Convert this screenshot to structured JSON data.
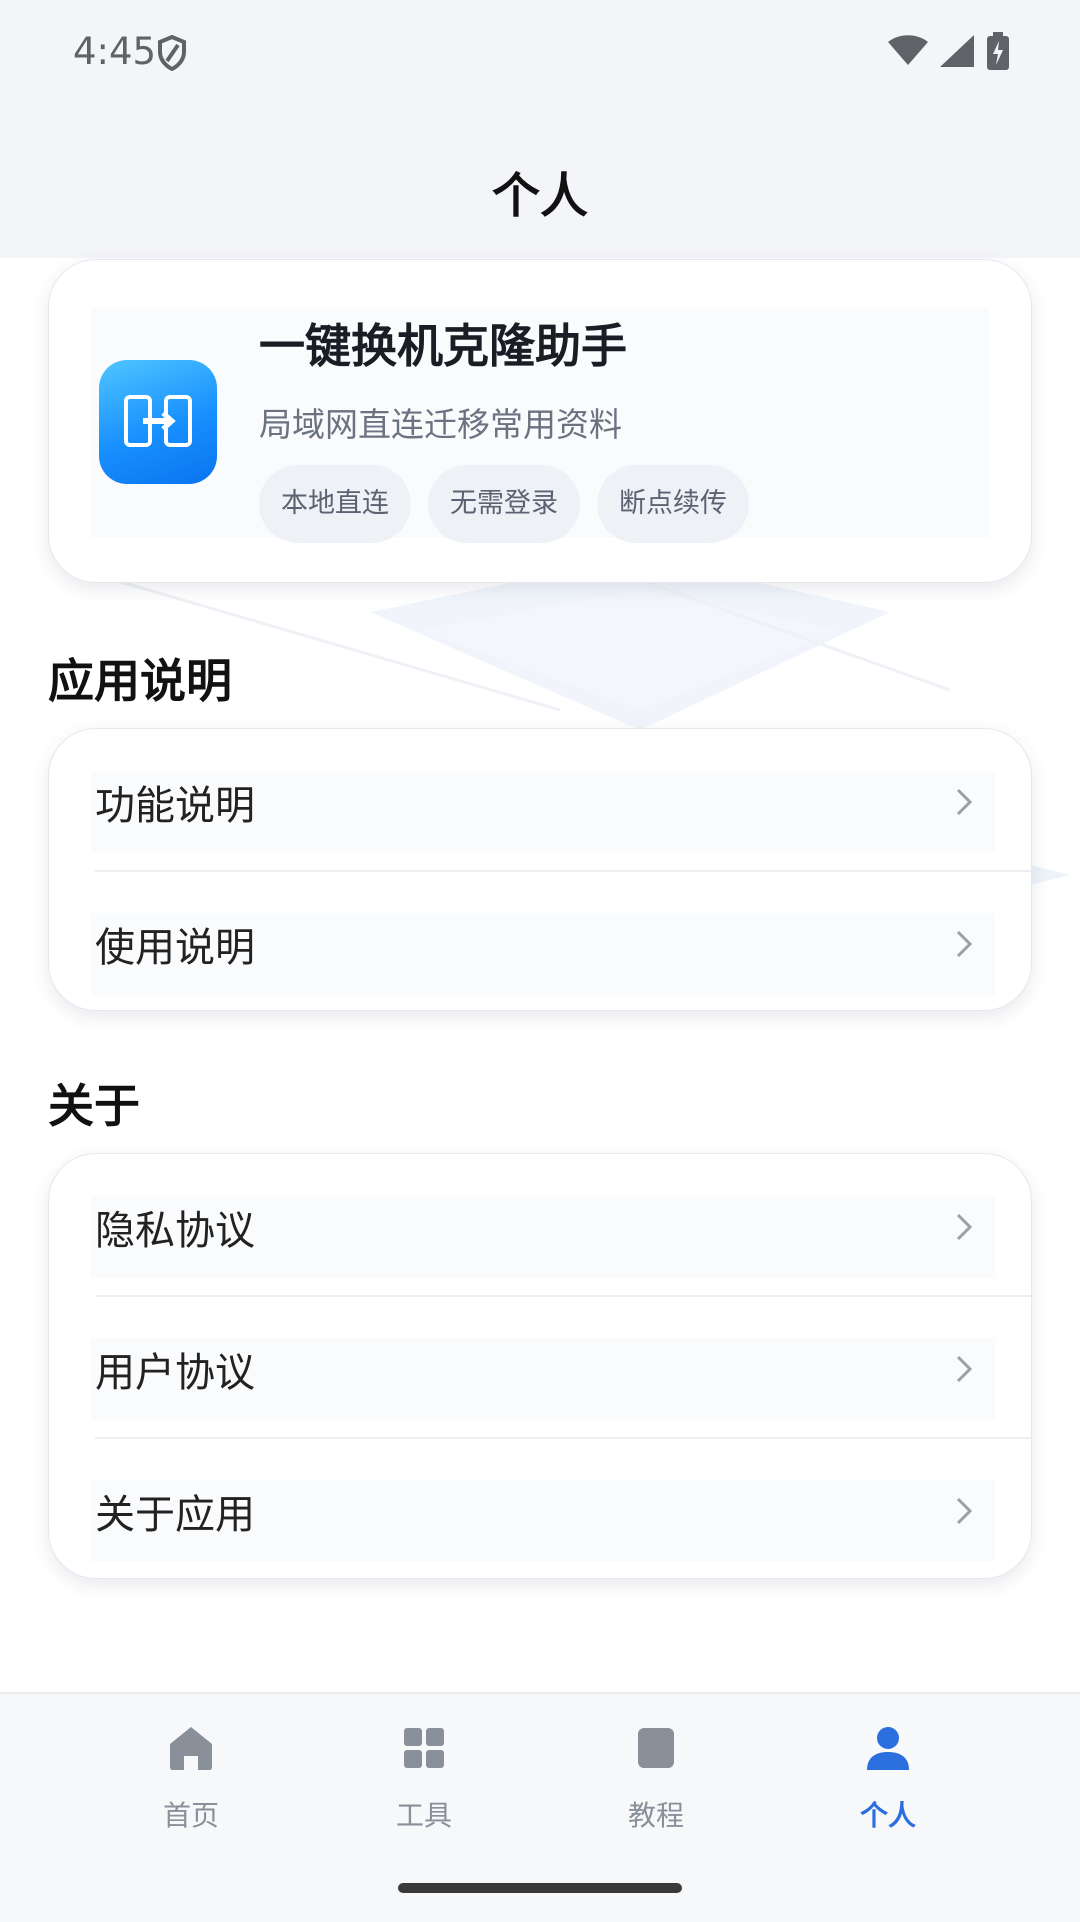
{
  "status_bar": {
    "time": "4:45"
  },
  "header": {
    "title": "个人"
  },
  "app_card": {
    "name": "一键换机克隆助手",
    "description": "局域网直连迁移常用资料",
    "tags": [
      "本地直连",
      "无需登录",
      "断点续传"
    ]
  },
  "sections": [
    {
      "title": "应用说明",
      "items": [
        {
          "label": "功能说明"
        },
        {
          "label": "使用说明"
        }
      ]
    },
    {
      "title": "关于",
      "items": [
        {
          "label": "隐私协议"
        },
        {
          "label": "用户协议"
        },
        {
          "label": "关于应用"
        }
      ]
    }
  ],
  "tabbar": {
    "tabs": [
      {
        "label": "首页",
        "icon": "home-icon"
      },
      {
        "label": "工具",
        "icon": "grid-icon"
      },
      {
        "label": "教程",
        "icon": "book-icon"
      },
      {
        "label": "个人",
        "icon": "person-icon"
      }
    ],
    "active_index": 3
  },
  "colors": {
    "accent": "#2b6fde",
    "app_icon": "#1890ff",
    "background": "#f4f5f9"
  }
}
